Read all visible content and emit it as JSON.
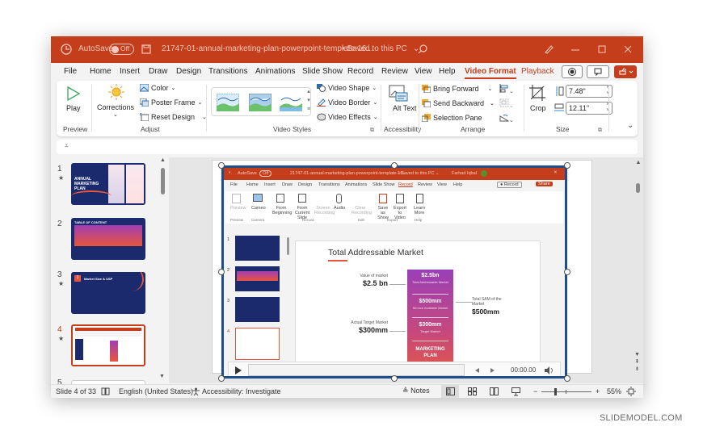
{
  "titlebar": {
    "autosave_label": "AutoSave",
    "autosave_state": "Off",
    "filename": "21747-01-annual-marketing-plan-powerpoint-template-16...",
    "save_status": "• Saved to this PC",
    "save_status_chevron": "⌄"
  },
  "menu": {
    "tabs": [
      "File",
      "Home",
      "Insert",
      "Draw",
      "Design",
      "Transitions",
      "Animations",
      "Slide Show",
      "Record",
      "Review",
      "View",
      "Help",
      "Video Format",
      "Playback"
    ],
    "active_tab": "Video Format"
  },
  "ribbon": {
    "preview": {
      "play_label": "Play",
      "group_label": "Preview"
    },
    "adjust": {
      "corrections_label": "Corrections",
      "color_label": "Color",
      "poster_frame_label": "Poster Frame",
      "reset_design_label": "Reset Design",
      "group_label": "Adjust"
    },
    "video_styles": {
      "group_label": "Video Styles",
      "video_shape_label": "Video Shape",
      "video_border_label": "Video Border",
      "video_effects_label": "Video Effects"
    },
    "accessibility": {
      "alt_text_label": "Alt Text",
      "group_label": "Accessibility"
    },
    "arrange": {
      "bring_forward_label": "Bring Forward",
      "send_backward_label": "Send Backward",
      "selection_pane_label": "Selection Pane",
      "group_label": "Arrange"
    },
    "size": {
      "crop_label": "Crop",
      "height_value": "7.48\"",
      "width_value": "12.11\"",
      "group_label": "Size"
    }
  },
  "thumbnails": [
    {
      "number": "1",
      "title": "ANNUAL MARKETING PLAN"
    },
    {
      "number": "2",
      "title": "TABLE OF CONTENT"
    },
    {
      "number": "3",
      "title": "Market Size & USP",
      "badge": "1"
    },
    {
      "number": "4",
      "title": "Total Addressable Market",
      "selected": true
    },
    {
      "number": "5",
      "title": ""
    }
  ],
  "embedded_video": {
    "titlebar": {
      "autosave_label": "AutoSave",
      "autosave_state": "Off",
      "filename": "21747-01-annual-marketing-plan-powerpoint-template-16...",
      "save_status": "• Saved to this PC ⌄",
      "user": "Farhad Iqbal"
    },
    "tabs": [
      "File",
      "Home",
      "Insert",
      "Draw",
      "Design",
      "Transitions",
      "Animations",
      "Slide Show",
      "Record",
      "Review",
      "View",
      "Help"
    ],
    "active_tab": "Record",
    "record_button": "Record",
    "share_button": "Share",
    "ribbon_items": [
      {
        "label": "Preview",
        "group": "Preview"
      },
      {
        "label": "Cameo",
        "group": "Camera"
      },
      {
        "label": "From Beginning",
        "group": "Record"
      },
      {
        "label": "From Current Slide",
        "group": "Record"
      },
      {
        "label": "Screen Recording",
        "group": "Record"
      },
      {
        "label": "Audio",
        "group": "Record"
      },
      {
        "label": "Clear Recording",
        "group": "Edit"
      },
      {
        "label": "Save as Show",
        "group": "Export"
      },
      {
        "label": "Export to Video",
        "group": "Export"
      },
      {
        "label": "Learn More",
        "group": "Help"
      }
    ],
    "group_labels": [
      "Preview",
      "Camera",
      "Record",
      "Edit",
      "Export",
      "Help"
    ],
    "slide": {
      "title": "Total Addressable Market",
      "left_labels": [
        {
          "caption": "Value of market",
          "value": "$2.5 bn"
        },
        {
          "caption": "Actual Target Market",
          "value": "$300mm"
        }
      ],
      "right_label": {
        "caption": "Total SAM of the Market",
        "value": "$500mm"
      },
      "column": [
        {
          "value": "$2.5bn",
          "caption": "Total Addressable Market"
        },
        {
          "value": "$500mm",
          "caption": "Service Available Market"
        },
        {
          "value": "$300mm",
          "caption": "Target Market"
        },
        {
          "value": "MARKETING PLAN",
          "caption": ""
        }
      ]
    },
    "player": {
      "time": "00:00.00"
    }
  },
  "statusbar": {
    "slide_info": "Slide 4 of 33",
    "language": "English (United States)",
    "accessibility": "Accessibility: Investigate",
    "notes_label": "Notes",
    "zoom_minus": "−",
    "zoom_plus": "+",
    "zoom_percent": "55%",
    "zoom_level": 0.55
  },
  "watermark": "SLIDEMODEL.COM",
  "colors": {
    "accent": "#c43e1c",
    "selection": "#1f4e8c",
    "slide_navy": "#1a2a6c"
  }
}
